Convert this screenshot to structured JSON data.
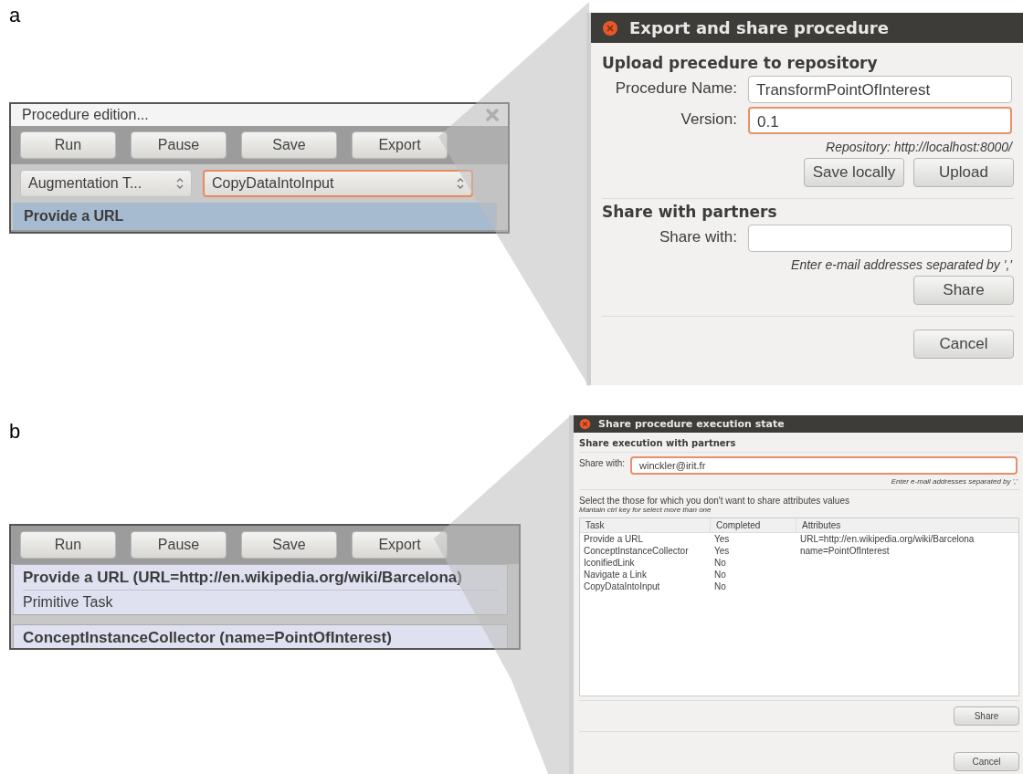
{
  "panel_a": {
    "label": "a",
    "editor": {
      "title": "Procedure edition...",
      "buttons": [
        "Run",
        "Pause",
        "Save",
        "Export"
      ],
      "selects": [
        {
          "value": "Augmentation T...",
          "focused": false
        },
        {
          "value": "CopyDataIntoInput",
          "focused": true
        }
      ],
      "tasks": [
        {
          "title": "Provide a URL",
          "selected": true
        }
      ]
    },
    "dialog": {
      "title": "Export and share procedure",
      "sections": [
        {
          "heading": "Upload precedure to repository",
          "fields": [
            {
              "label": "Procedure Name:",
              "value": "TransformPointOfInterest",
              "focused": false
            },
            {
              "label": "Version:",
              "value": "0.1",
              "focused": true
            }
          ],
          "hint": "Repository: http://localhost:8000/",
          "buttons": [
            "Save locally",
            "Upload"
          ]
        },
        {
          "heading": "Share with partners",
          "fields": [
            {
              "label": "Share with:",
              "focused": false
            }
          ],
          "hint": "Enter e-mail addresses separated by ','",
          "buttons": [
            "Share"
          ]
        }
      ],
      "footer_buttons": [
        "Cancel"
      ]
    }
  },
  "panel_b": {
    "label": "b",
    "editor": {
      "buttons": [
        "Run",
        "Pause",
        "Save",
        "Export"
      ],
      "tasks": [
        {
          "title": "Provide a URL (URL=http://en.wikipedia.org/wiki/Barcelona)",
          "subtitle": "Primitive Task",
          "selected": false
        },
        {
          "title": "ConceptInstanceCollector (name=PointOfInterest)",
          "selected": false
        }
      ]
    },
    "dialog": {
      "title": "Share procedure execution state",
      "heading": "Share execution with partners",
      "field": {
        "label": "Share with:",
        "value": "winckler@irit.fr",
        "focused": true
      },
      "hint": "Enter e-mail addresses separated by ','",
      "instruction": "Select the those for which you don't want to share attributes values",
      "note": "Mantain ctrl key for select more than one",
      "table": {
        "columns": [
          "Task",
          "Completed",
          "Attributes"
        ],
        "rows": [
          {
            "task": "Provide a URL",
            "completed": "Yes",
            "attributes": "URL=http://en.wikipedia.org/wiki/Barcelona"
          },
          {
            "task": "ConceptInstanceCollector",
            "completed": "Yes",
            "attributes": "name=PointOfInterest"
          },
          {
            "task": "IconifiedLink",
            "completed": "No"
          },
          {
            "task": "Navigate a Link",
            "completed": "No"
          },
          {
            "task": "CopyDataIntoInput",
            "completed": "No"
          }
        ]
      },
      "buttons": [
        "Share"
      ],
      "footer_buttons": [
        "Cancel"
      ]
    }
  }
}
